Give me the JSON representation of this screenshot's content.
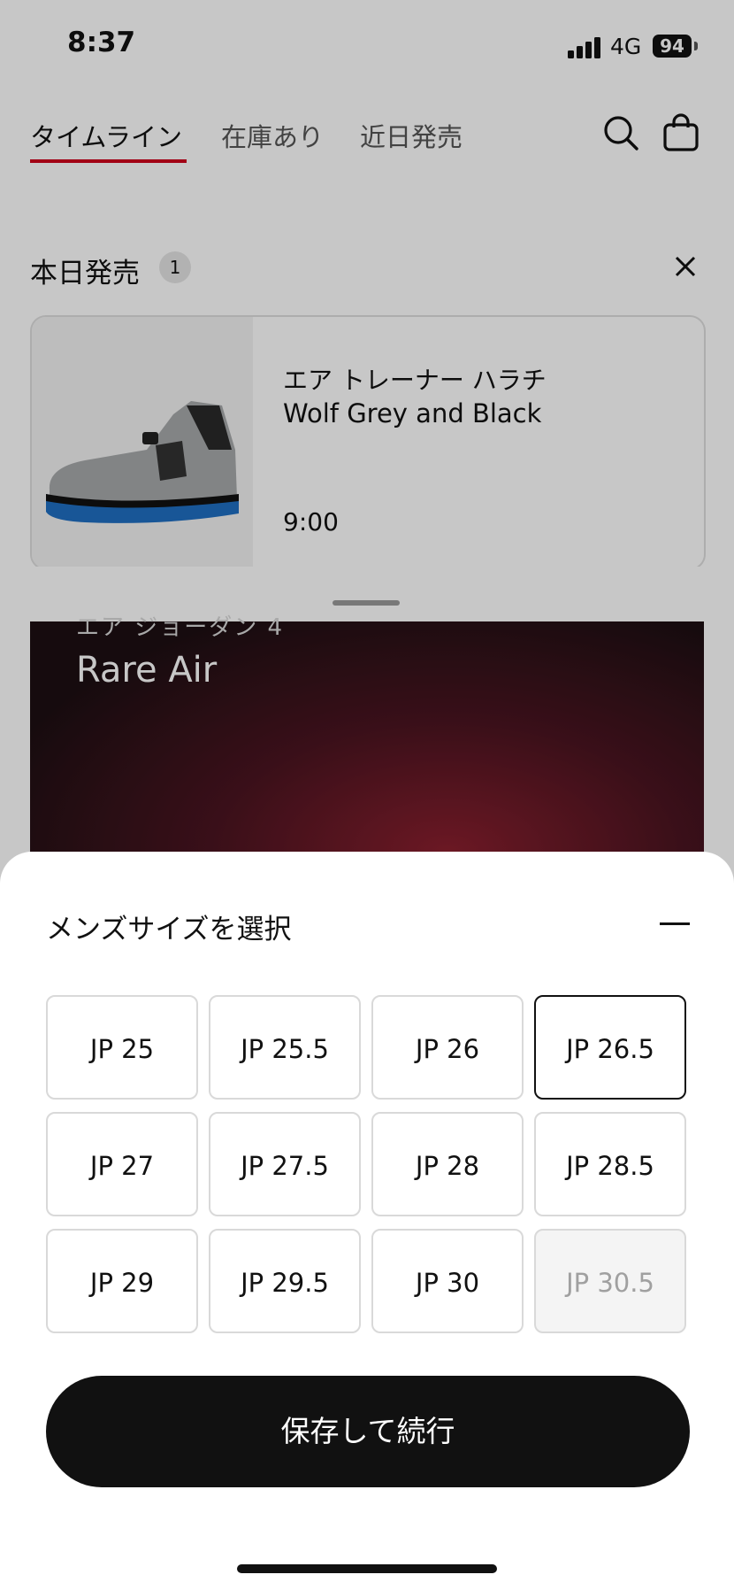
{
  "status_bar": {
    "time": "8:37",
    "network": "4G",
    "battery": "94"
  },
  "nav": {
    "tabs": [
      {
        "label": "タイムライン",
        "active": true
      },
      {
        "label": "在庫あり",
        "active": false
      },
      {
        "label": "近日発売",
        "active": false
      }
    ],
    "icons": [
      "search-icon",
      "bag-icon"
    ]
  },
  "today_release": {
    "title": "本日発売",
    "count": "1",
    "product": {
      "name": "エア トレーナー ハラチ",
      "colorway": "Wolf Grey and Black",
      "time": "9:00"
    }
  },
  "feature": {
    "subtitle": "エア ジョーダン 4",
    "title": "Rare Air"
  },
  "size_picker": {
    "title": "メンズサイズを選択",
    "sizes": [
      {
        "label": "JP 25",
        "state": "available"
      },
      {
        "label": "JP 25.5",
        "state": "available"
      },
      {
        "label": "JP 26",
        "state": "available"
      },
      {
        "label": "JP 26.5",
        "state": "selected"
      },
      {
        "label": "JP 27",
        "state": "available"
      },
      {
        "label": "JP 27.5",
        "state": "available"
      },
      {
        "label": "JP 28",
        "state": "available"
      },
      {
        "label": "JP 28.5",
        "state": "available"
      },
      {
        "label": "JP 29",
        "state": "available"
      },
      {
        "label": "JP 29.5",
        "state": "available"
      },
      {
        "label": "JP 30",
        "state": "available"
      },
      {
        "label": "JP 30.5",
        "state": "disabled"
      }
    ],
    "save_label": "保存して続行"
  },
  "colors": {
    "accent": "#d0021b",
    "button": "#111111"
  }
}
